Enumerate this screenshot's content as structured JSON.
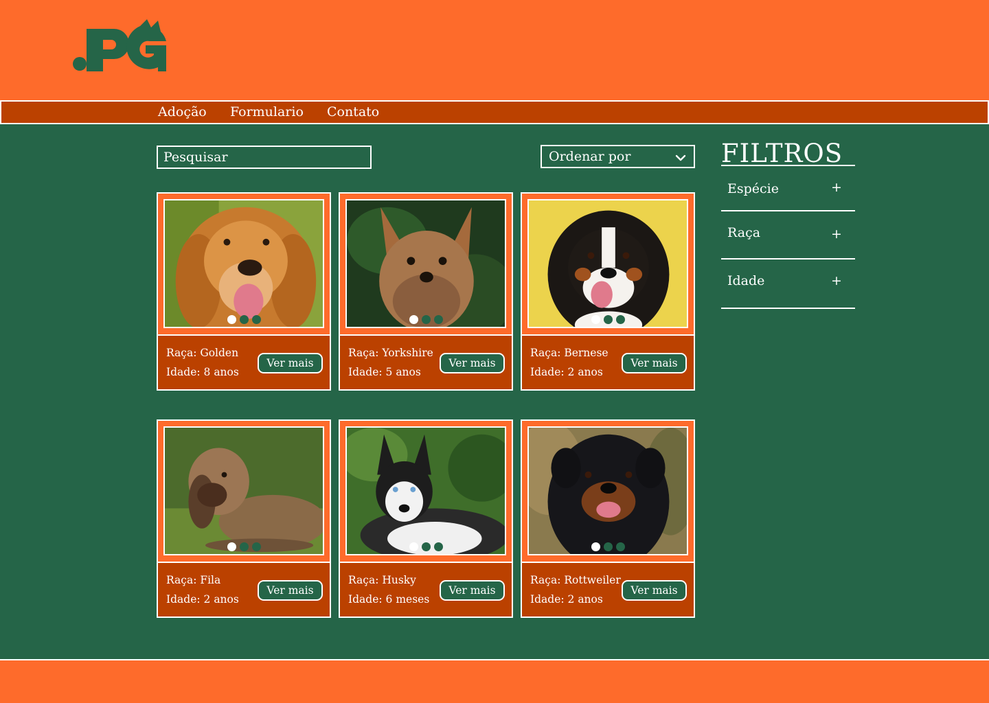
{
  "colors": {
    "header": "#fe6b2b",
    "nav": "#bb4100",
    "page": "#256548",
    "card": "#fe6b2b",
    "card_info": "#bb4100",
    "text": "#ffffff"
  },
  "nav": {
    "items": [
      {
        "label": "Adoção"
      },
      {
        "label": "Formulario"
      },
      {
        "label": "Contato"
      }
    ]
  },
  "search": {
    "placeholder": "Pesquisar"
  },
  "sort": {
    "label": "Ordenar por",
    "icon": "chevron-down-icon"
  },
  "filters": {
    "title": "FILTROS",
    "items": [
      {
        "label": "Espécie",
        "icon": "plus-icon"
      },
      {
        "label": "Raça",
        "icon": "plus-icon"
      },
      {
        "label": "Idade",
        "icon": "plus-icon"
      }
    ]
  },
  "cards": [
    {
      "breed": "Raça: Golden",
      "age": "Idade: 8 anos",
      "button": "Ver mais"
    },
    {
      "breed": "Raça: Yorkshire",
      "age": "Idade: 5 anos",
      "button": "Ver mais"
    },
    {
      "breed": "Raça: Bernese",
      "age": "Idade: 2 anos",
      "button": "Ver mais"
    },
    {
      "breed": "Raça: Fila",
      "age": "Idade: 2 anos",
      "button": "Ver mais"
    },
    {
      "breed": "Raça: Husky",
      "age": "Idade: 6 meses",
      "button": "Ver mais"
    },
    {
      "breed": "Raça: Rottweiler",
      "age": "Idade: 2 anos",
      "button": "Ver mais"
    }
  ]
}
